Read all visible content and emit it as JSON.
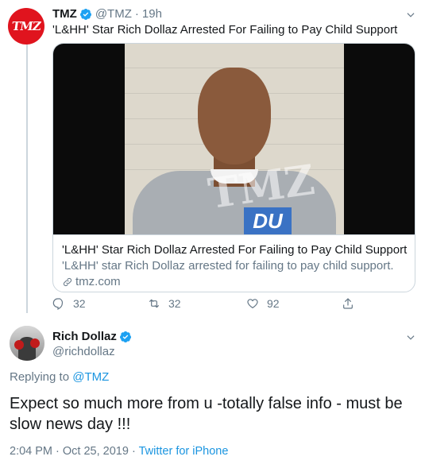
{
  "tweet1": {
    "avatar_text": "TMZ",
    "name": "TMZ",
    "handle": "@TMZ",
    "separator": "·",
    "time": "19h",
    "text": "'L&HH' Star Rich Dollaz Arrested For Failing to Pay Child Support",
    "card": {
      "watermark": "TMZ",
      "shirt_logo": "DU",
      "title": "'L&HH' Star Rich Dollaz Arrested For Failing to Pay Child Support",
      "description": "'L&HH' star Rich Dollaz arrested for failing to pay child support.",
      "domain": "tmz.com"
    },
    "actions": {
      "replies": "32",
      "retweets": "32",
      "likes": "92"
    }
  },
  "tweet2": {
    "name": "Rich Dollaz",
    "handle": "@richdollaz",
    "replying_prefix": "Replying to",
    "replying_to": "@TMZ",
    "text": "Expect so much more from u -totally false info - must be slow news day !!!",
    "time": "2:04 PM",
    "separator": "·",
    "date": "Oct 25, 2019",
    "separator2": "·",
    "source": "Twitter for iPhone"
  },
  "colors": {
    "accent": "#1b95e0",
    "verified": "#1da1f2",
    "muted": "#657786",
    "tmz_red": "#e0141e"
  },
  "icons": {
    "verified": "verified-badge-icon",
    "chevron": "chevron-down-icon",
    "reply": "reply-icon",
    "retweet": "retweet-icon",
    "like": "heart-icon",
    "share": "share-icon",
    "link": "link-icon"
  }
}
